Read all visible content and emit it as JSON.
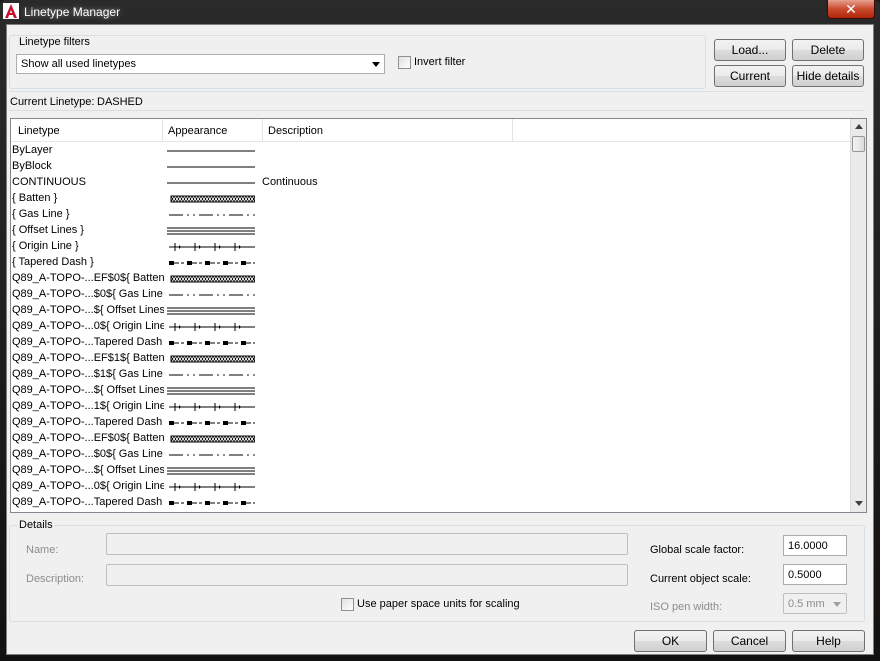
{
  "window": {
    "title": "Linetype Manager",
    "close_glyph": "✕"
  },
  "filters": {
    "group_label": "Linetype filters",
    "selected": "Show all used linetypes",
    "invert_label": "Invert filter"
  },
  "buttons": {
    "load": "Load...",
    "delete": "Delete",
    "current": "Current",
    "hide_details": "Hide details"
  },
  "current_linetype": {
    "label": "Current Linetype:",
    "value": "DASHED"
  },
  "list": {
    "columns": [
      "Linetype",
      "Appearance",
      "Description"
    ],
    "rows": [
      {
        "name": "ByLayer",
        "pattern": "solid",
        "desc": ""
      },
      {
        "name": "ByBlock",
        "pattern": "solid",
        "desc": ""
      },
      {
        "name": "CONTINUOUS",
        "pattern": "solid",
        "desc": "Continuous"
      },
      {
        "name": "{ Batten }",
        "pattern": "batten",
        "desc": ""
      },
      {
        "name": "{ Gas Line }",
        "pattern": "gas",
        "desc": ""
      },
      {
        "name": "{ Offset Lines }",
        "pattern": "offset",
        "desc": ""
      },
      {
        "name": "{ Origin Line }",
        "pattern": "origin",
        "desc": ""
      },
      {
        "name": "{ Tapered Dash }",
        "pattern": "tapered",
        "desc": ""
      },
      {
        "name": "Q89_A-TOPO-...EF$0${ Batten",
        "pattern": "batten",
        "desc": ""
      },
      {
        "name": "Q89_A-TOPO-...$0${ Gas Line }",
        "pattern": "gas",
        "desc": ""
      },
      {
        "name": "Q89_A-TOPO-...${ Offset Lines",
        "pattern": "offset",
        "desc": ""
      },
      {
        "name": "Q89_A-TOPO-...0${ Origin Line",
        "pattern": "origin",
        "desc": ""
      },
      {
        "name": "Q89_A-TOPO-...Tapered Dash }",
        "pattern": "tapered",
        "desc": ""
      },
      {
        "name": "Q89_A-TOPO-...EF$1${ Batten",
        "pattern": "batten",
        "desc": ""
      },
      {
        "name": "Q89_A-TOPO-...$1${ Gas Line }",
        "pattern": "gas",
        "desc": ""
      },
      {
        "name": "Q89_A-TOPO-...${ Offset Lines",
        "pattern": "offset",
        "desc": ""
      },
      {
        "name": "Q89_A-TOPO-...1${ Origin Line",
        "pattern": "origin",
        "desc": ""
      },
      {
        "name": "Q89_A-TOPO-...Tapered Dash }",
        "pattern": "tapered",
        "desc": ""
      },
      {
        "name": "Q89_A-TOPO-...EF$0${ Batten",
        "pattern": "batten",
        "desc": ""
      },
      {
        "name": "Q89_A-TOPO-...$0${ Gas Line }",
        "pattern": "gas",
        "desc": ""
      },
      {
        "name": "Q89_A-TOPO-...${ Offset Lines",
        "pattern": "offset",
        "desc": ""
      },
      {
        "name": "Q89_A-TOPO-...0${ Origin Line",
        "pattern": "origin",
        "desc": ""
      },
      {
        "name": "Q89_A-TOPO-...Tapered Dash }",
        "pattern": "tapered",
        "desc": ""
      }
    ]
  },
  "details": {
    "group_label": "Details",
    "name_label": "Name:",
    "description_label": "Description:",
    "paper_space_label": "Use paper space units for scaling",
    "global_scale_label": "Global scale factor:",
    "global_scale_value": "16.0000",
    "object_scale_label": "Current object scale:",
    "object_scale_value": "0.5000",
    "iso_pen_label": "ISO pen width:",
    "iso_pen_value": "0.5 mm"
  },
  "footer": {
    "ok": "OK",
    "cancel": "Cancel",
    "help": "Help"
  },
  "colors": {
    "close_red": "#c94a2e",
    "app_icon_red": "#c8102e"
  }
}
